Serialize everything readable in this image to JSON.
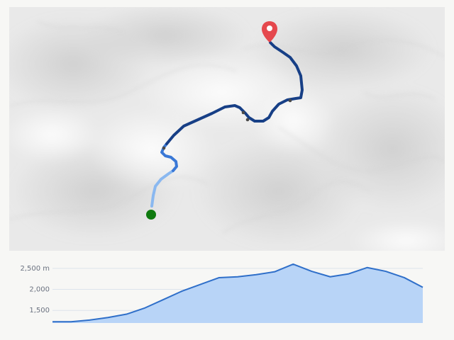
{
  "map": {
    "start_marker": {
      "icon": "start-dot-icon",
      "color": "#0f7a0f"
    },
    "end_marker": {
      "icon": "map-pin-icon",
      "color": "#e5484d"
    },
    "route": {
      "colors": {
        "light": "#8ab8f0",
        "medium": "#3a78d6",
        "dark": "#173f86"
      }
    }
  },
  "elevation_profile": {
    "y_tick_labels": [
      "2,500 m",
      "2,000",
      "1,500"
    ],
    "y_ticks": [
      2500,
      2000,
      1500
    ],
    "ylim": [
      1200,
      2650
    ],
    "fill_color": "#b8d4f7",
    "line_color": "#2f6fc9"
  },
  "chart_data": {
    "type": "area",
    "title": "",
    "xlabel": "",
    "ylabel": "",
    "ylim": [
      1200,
      2650
    ],
    "x": [
      0,
      5,
      10,
      15,
      20,
      25,
      30,
      35,
      40,
      45,
      50,
      55,
      60,
      65,
      70,
      75,
      80,
      85,
      90,
      95,
      100
    ],
    "series": [
      {
        "values": [
          1230,
          1230,
          1270,
          1330,
          1410,
          1560,
          1760,
          1960,
          2120,
          2280,
          2300,
          2350,
          2420,
          2600,
          2430,
          2300,
          2370,
          2520,
          2430,
          2280,
          2050
        ]
      }
    ],
    "grid": true
  }
}
